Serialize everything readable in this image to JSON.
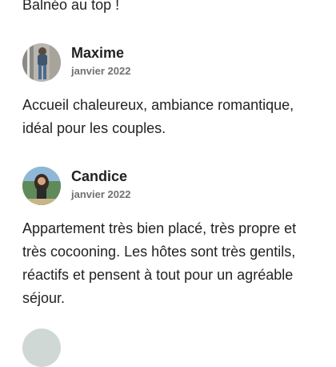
{
  "reviews": [
    {
      "text": "Balnéo au top !"
    },
    {
      "author": "Maxime",
      "date": "janvier 2022",
      "text": "Accueil chaleureux, ambiance romantique, idéal pour les couples."
    },
    {
      "author": "Candice",
      "date": "janvier 2022",
      "text": "Appartement très bien placé, très propre et très cocooning. Les hôtes sont très gentils, réactifs et pensent à tout pour un agréable séjour."
    }
  ],
  "colors": {
    "text": "#222222",
    "secondary_text": "#717171",
    "background": "#ffffff"
  }
}
